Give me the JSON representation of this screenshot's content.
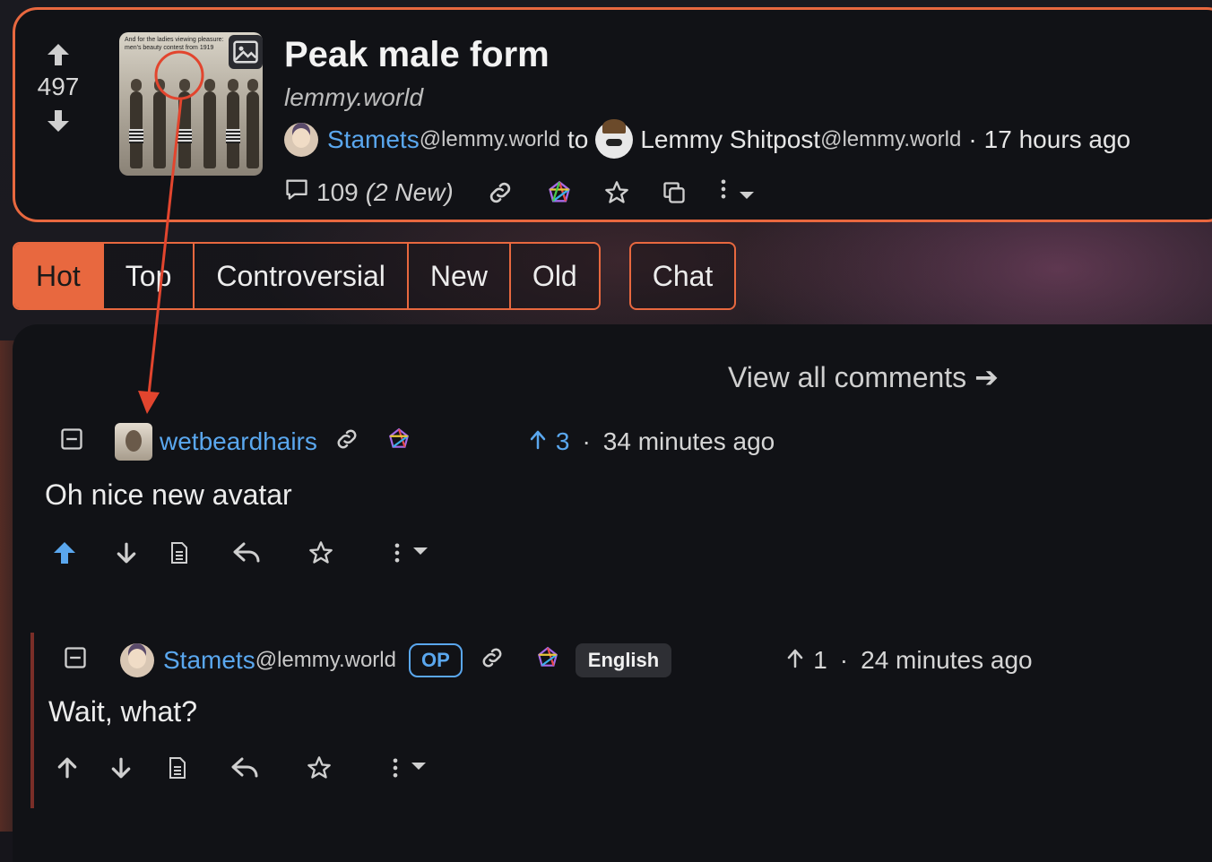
{
  "post": {
    "score": "497",
    "title": "Peak male form",
    "domain": "lemmy.world",
    "thumbnail_caption": "And for the ladies viewing pleasure: men's beauty contest from 1919",
    "author": "Stamets",
    "author_instance": "@lemmy.world",
    "to_label": "to",
    "community": "Lemmy Shitpost",
    "community_instance": "@lemmy.world",
    "separator": "·",
    "time": "17 hours ago",
    "comments_count": "109",
    "comments_new": "(2 New)"
  },
  "sort_tabs": [
    "Hot",
    "Top",
    "Controversial",
    "New",
    "Old"
  ],
  "active_tab": "Hot",
  "chat_label": "Chat",
  "view_all": "View all comments ➔",
  "comments": [
    {
      "author": "wetbeardhairs",
      "score": "3",
      "separator": "·",
      "time": "34 minutes ago",
      "body": "Oh nice new avatar"
    },
    {
      "author": "Stamets",
      "author_instance": "@lemmy.world",
      "badge": "OP",
      "language": "English",
      "score": "1",
      "separator": "·",
      "time": "24 minutes ago",
      "body": "Wait, what?"
    }
  ],
  "colors": {
    "accent": "#e8683f",
    "link": "#5aa7ee",
    "background": "#111216"
  },
  "icons": [
    "upvote-icon",
    "downvote-icon",
    "image-icon",
    "comment-icon",
    "link-icon",
    "fediverse-icon",
    "star-icon",
    "copy-icon",
    "more-icon",
    "caret-down-icon",
    "collapse-icon",
    "source-icon",
    "reply-icon"
  ]
}
